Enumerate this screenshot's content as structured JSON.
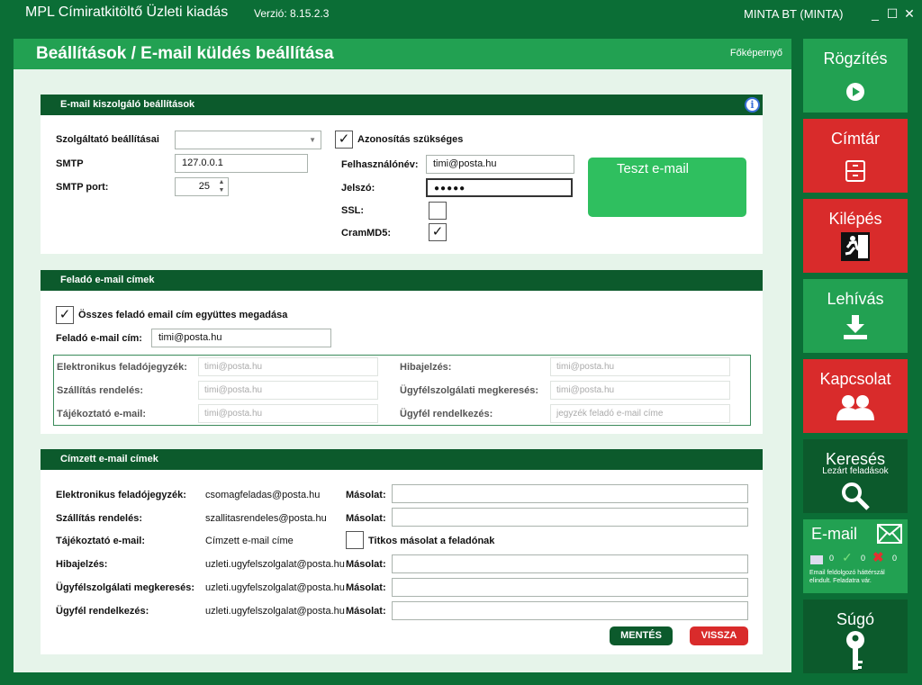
{
  "titlebar": {
    "title": "MPL Címiratkitöltő Üzleti kiadás",
    "version": "Verzió: 8.15.2.3",
    "user": "MINTA BT (MINTA)"
  },
  "header": {
    "title": "Beállítások / E-mail küldés beállítása",
    "home_link": "Főképernyő"
  },
  "server": {
    "heading": "E-mail kiszolgáló beállítások",
    "provider_label": "Szolgáltató beállításai",
    "provider_value": "",
    "smtp_label": "SMTP",
    "smtp_value": "127.0.0.1",
    "port_label": "SMTP port:",
    "port_value": "25",
    "auth_label": "Azonosítás szükséges",
    "auth_checked": "✓",
    "user_label": "Felhasználónév:",
    "user_value": "timi@posta.hu",
    "pass_label": "Jelszó:",
    "pass_value": "●●●●●",
    "ssl_label": "SSL:",
    "ssl_checked": "",
    "cram_label": "CramMD5:",
    "cram_checked": "✓",
    "test_button": "Teszt e-mail"
  },
  "sender": {
    "heading": "Feladó e-mail címek",
    "all_label": "Összes feladó email cím együttes megadása",
    "all_checked": "✓",
    "addr_label": "Feladó e-mail cím:",
    "addr_value": "timi@posta.hu",
    "rows": [
      {
        "label": "Elektronikus feladójegyzék:",
        "value": "timi@posta.hu"
      },
      {
        "label": "Szállítás rendelés:",
        "value": "timi@posta.hu"
      },
      {
        "label": "Tájékoztató e-mail:",
        "value": "timi@posta.hu"
      },
      {
        "label": "Hibajelzés:",
        "value": "timi@posta.hu"
      },
      {
        "label": "Ügyfélszolgálati megkeresés:",
        "value": "timi@posta.hu"
      },
      {
        "label": "Ügyfél rendelkezés:",
        "value": "jegyzék feladó e-mail címe"
      }
    ]
  },
  "recipient": {
    "heading": "Címzett e-mail címek",
    "copy_label": "Másolat:",
    "rows": [
      {
        "label": "Elektronikus feladójegyzék:",
        "value": "csomagfeladas@posta.hu",
        "copy": ""
      },
      {
        "label": "Szállítás rendelés:",
        "value": "szallitasrendeles@posta.hu",
        "copy": ""
      },
      {
        "label": "Tájékoztató e-mail:",
        "value": "Címzett e-mail címe"
      },
      {
        "label": "Hibajelzés:",
        "value": "uzleti.ugyfelszolgalat@posta.hu",
        "copy": ""
      },
      {
        "label": "Ügyfélszolgálati megkeresés:",
        "value": "uzleti.ugyfelszolgalat@posta.hu",
        "copy": ""
      },
      {
        "label": "Ügyfél rendelkezés:",
        "value": "uzleti.ugyfelszolgalat@posta.hu",
        "copy": ""
      }
    ],
    "bcc_label": "Titkos másolat a feladónak",
    "bcc_checked": ""
  },
  "buttons": {
    "save": "MENTÉS",
    "back": "VISSZA"
  },
  "sidebar": {
    "record": "Rögzítés",
    "directory": "Címtár",
    "exit": "Kilépés",
    "fetch": "Lehívás",
    "contact": "Kapcsolat",
    "search": "Keresés",
    "search_sub": "Lezárt feladások",
    "email": "E-mail",
    "email_count1": "0",
    "email_count2": "0",
    "email_count3": "0",
    "email_status": "Email feldolgozó háttérszál elindult. Feladatra vár.",
    "help": "Súgó"
  },
  "colors": {
    "dark_green": "#0c5a2c",
    "green": "#22a152",
    "red": "#d92b2b"
  }
}
